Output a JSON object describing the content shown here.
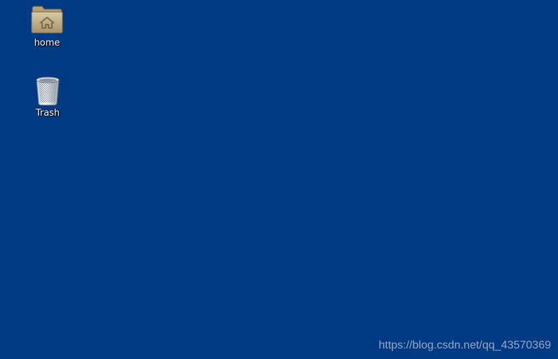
{
  "desktop": {
    "background_color": "#003a84",
    "icons": [
      {
        "label": "home",
        "icon": "home-folder-icon"
      },
      {
        "label": "Trash",
        "icon": "trash-can-icon"
      }
    ]
  },
  "watermark": {
    "text": "https://blog.csdn.net/qq_43570369"
  }
}
